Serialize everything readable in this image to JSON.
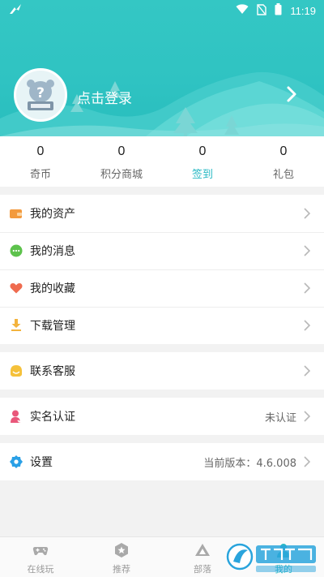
{
  "status": {
    "time": "11:19"
  },
  "profile": {
    "login_text": "点击登录"
  },
  "stats": [
    {
      "num": "0",
      "label": "奇币"
    },
    {
      "num": "0",
      "label": "积分商城"
    },
    {
      "num": "0",
      "label": "签到"
    },
    {
      "num": "0",
      "label": "礼包"
    }
  ],
  "menu": {
    "assets": "我的资产",
    "messages": "我的消息",
    "favorites": "我的收藏",
    "downloads": "下载管理",
    "support": "联系客服",
    "realname": {
      "label": "实名认证",
      "value": "未认证"
    },
    "settings": {
      "label": "设置",
      "value": "当前版本：4.6.008"
    }
  },
  "tabs": [
    {
      "label": "在线玩"
    },
    {
      "label": "推荐"
    },
    {
      "label": "部落"
    },
    {
      "label": "我的"
    }
  ],
  "colors": {
    "accent": "#29b9c4",
    "header": "#2fc3c2"
  }
}
